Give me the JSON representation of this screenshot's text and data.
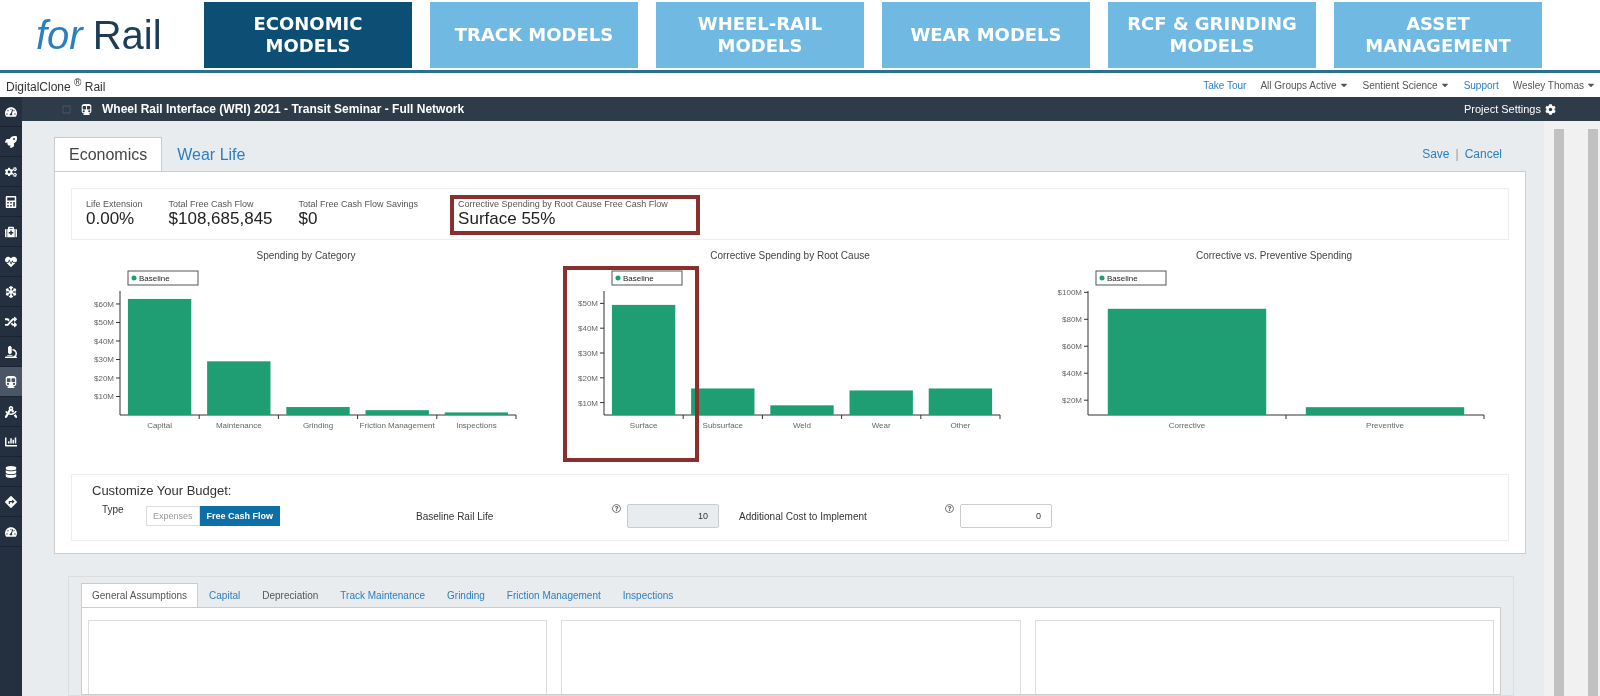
{
  "logo": {
    "prefix": "for",
    "name": "Rail"
  },
  "model_tabs": [
    {
      "label": "ECONOMIC MODELS",
      "selected": true
    },
    {
      "label": "TRACK MODELS",
      "selected": false
    },
    {
      "label": "WHEEL-RAIL MODELS",
      "selected": false
    },
    {
      "label": "WEAR MODELS",
      "selected": false
    },
    {
      "label": "RCF & GRINDING MODELS",
      "selected": false
    },
    {
      "label": "ASSET MANAGEMENT",
      "selected": false
    }
  ],
  "app": {
    "name": "DigitalClone",
    "mark": "®",
    "product": "Rail"
  },
  "nav_links": [
    {
      "label": "Take Tour",
      "kind": "link"
    },
    {
      "label": "All Groups Active",
      "kind": "dropdown"
    },
    {
      "label": "Sentient Science",
      "kind": "dropdown"
    },
    {
      "label": "Support",
      "kind": "link"
    },
    {
      "label": "Wesley Thomas",
      "kind": "dropdown"
    }
  ],
  "project": {
    "title": "Wheel Rail Interface (WRI) 2021 - Transit Seminar - Full Network",
    "settings": "Project Settings"
  },
  "sidebar": {
    "items": [
      {
        "selected": false
      },
      {
        "selected": false
      },
      {
        "selected": false
      },
      {
        "selected": false
      },
      {
        "selected": false
      },
      {
        "selected": false
      },
      {
        "selected": false
      },
      {
        "selected": false
      },
      {
        "selected": false
      },
      {
        "selected": true
      },
      {
        "selected": false
      },
      {
        "selected": false
      },
      {
        "selected": false
      },
      {
        "selected": false
      },
      {
        "selected": false
      }
    ]
  },
  "tabs": [
    {
      "label": "Economics",
      "selected": true
    },
    {
      "label": "Wear Life",
      "selected": false
    }
  ],
  "actions": {
    "save": "Save",
    "separator": "|",
    "cancel": "Cancel"
  },
  "stats": [
    {
      "label": "Life Extension",
      "value": "0.00%",
      "highlighted": false
    },
    {
      "label": "Total Free Cash Flow",
      "value": "$108,685,845",
      "highlighted": false
    },
    {
      "label": "Total Free Cash Flow Savings",
      "value": "$0",
      "highlighted": false
    },
    {
      "label": "Corrective Spending by Root Cause Free Cash Flow",
      "value": "Surface 55%",
      "highlighted": true
    }
  ],
  "charts": [
    {
      "highlighted": false,
      "chart_data": {
        "type": "bar",
        "title": "Spending by Category",
        "categories": [
          "Capital",
          "Maintenance",
          "Grinding",
          "Friction Management",
          "Inspections"
        ],
        "series": [
          {
            "name": "Baseline",
            "color": "#1f9e74",
            "values": [
              62.7,
              29,
              4.3,
              2.6,
              1.4
            ]
          }
        ],
        "ylim": [
          0,
          67
        ],
        "yticks": [
          {
            "value": 10,
            "label": "$10M"
          },
          {
            "value": 20,
            "label": "$20M"
          },
          {
            "value": 30,
            "label": "$30M"
          },
          {
            "value": 40,
            "label": "$40M"
          },
          {
            "value": 50,
            "label": "$50M"
          },
          {
            "value": 60,
            "label": "$60M"
          }
        ]
      }
    },
    {
      "highlighted": true,
      "chart_data": {
        "type": "bar",
        "title": "Corrective Spending by Root Cause",
        "categories": [
          "Surface",
          "Subsurface",
          "Weld",
          "Wear",
          "Other"
        ],
        "series": [
          {
            "name": "Baseline",
            "color": "#1f9e74",
            "values": [
              49.4,
              15.7,
              8.9,
              14.9,
              15.7
            ]
          }
        ],
        "ylim": [
          5,
          55
        ],
        "yticks": [
          {
            "value": 10,
            "label": "$10M"
          },
          {
            "value": 20,
            "label": "$20M"
          },
          {
            "value": 30,
            "label": "$30M"
          },
          {
            "value": 40,
            "label": "$40M"
          },
          {
            "value": 50,
            "label": "$50M"
          }
        ]
      }
    },
    {
      "highlighted": false,
      "chart_data": {
        "type": "bar",
        "title": "Corrective vs. Preventive Spending",
        "categories": [
          "Corrective",
          "Preventive"
        ],
        "series": [
          {
            "name": "Baseline",
            "color": "#1f9e74",
            "values": [
              87.8,
              14.8
            ]
          }
        ],
        "ylim": [
          9,
          101
        ],
        "yticks": [
          {
            "value": 20,
            "label": "$20M"
          },
          {
            "value": 40,
            "label": "$40M"
          },
          {
            "value": 60,
            "label": "$60M"
          },
          {
            "value": 80,
            "label": "$80M"
          },
          {
            "value": 100,
            "label": "$100M"
          }
        ]
      }
    }
  ],
  "budget": {
    "title": "Customize Your Budget:",
    "type_label": "Type",
    "type_options": [
      {
        "label": "Expenses",
        "selected": false
      },
      {
        "label": "Free Cash Flow",
        "selected": true
      }
    ],
    "fields": [
      {
        "label": "Baseline Rail Life",
        "value": "10",
        "disabled": true
      },
      {
        "label": "Additional Cost to Implement",
        "value": "0",
        "disabled": false
      }
    ]
  },
  "assumption_tabs": [
    {
      "label": "General Assumptions",
      "selected": true,
      "disabled": false
    },
    {
      "label": "Capital",
      "selected": false,
      "disabled": false
    },
    {
      "label": "Depreciation",
      "selected": false,
      "disabled": true
    },
    {
      "label": "Track Maintenance",
      "selected": false,
      "disabled": false
    },
    {
      "label": "Grinding",
      "selected": false,
      "disabled": false
    },
    {
      "label": "Friction Management",
      "selected": false,
      "disabled": false
    },
    {
      "label": "Inspections",
      "selected": false,
      "disabled": false
    }
  ]
}
